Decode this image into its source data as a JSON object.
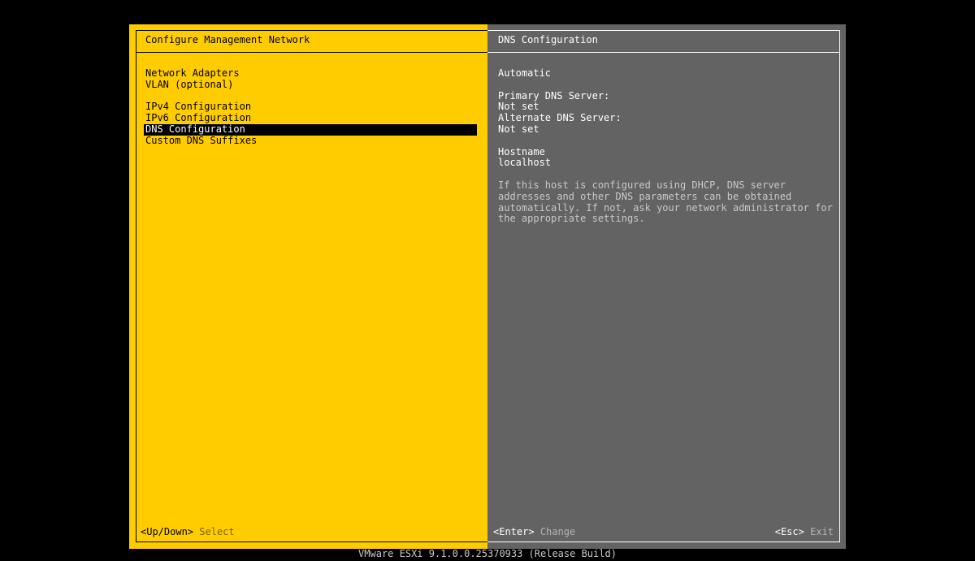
{
  "left": {
    "title": "Configure Management Network",
    "menu": [
      {
        "label": "Network Adapters"
      },
      {
        "label": "VLAN (optional)"
      },
      {
        "label": "IPv4 Configuration"
      },
      {
        "label": "IPv6 Configuration"
      },
      {
        "label": "DNS Configuration"
      },
      {
        "label": "Custom DNS Suffixes"
      }
    ],
    "footer": {
      "key": "<Up/Down>",
      "hint": "Select"
    }
  },
  "right": {
    "title": "DNS Configuration",
    "mode": "Automatic",
    "primary_label": "Primary DNS Server:",
    "primary_value": "Not set",
    "alternate_label": "Alternate DNS Server:",
    "alternate_value": "Not set",
    "hostname_label": "Hostname",
    "hostname_value": "localhost",
    "help": "If this host is configured using DHCP, DNS server addresses and other DNS parameters can be obtained automatically. If not, ask your network administrator for the appropriate settings.",
    "footer_left": {
      "key": "<Enter>",
      "hint": "Change"
    },
    "footer_right": {
      "key": "<Esc>",
      "hint": "Exit"
    }
  },
  "status_bar": "VMware ESXi 9.1.0.0.25370933 (Release Build)",
  "colors": {
    "left_panel": "#ffcc00",
    "right_panel": "#636363",
    "selection": "#000000"
  },
  "selected_menu_index": 4
}
